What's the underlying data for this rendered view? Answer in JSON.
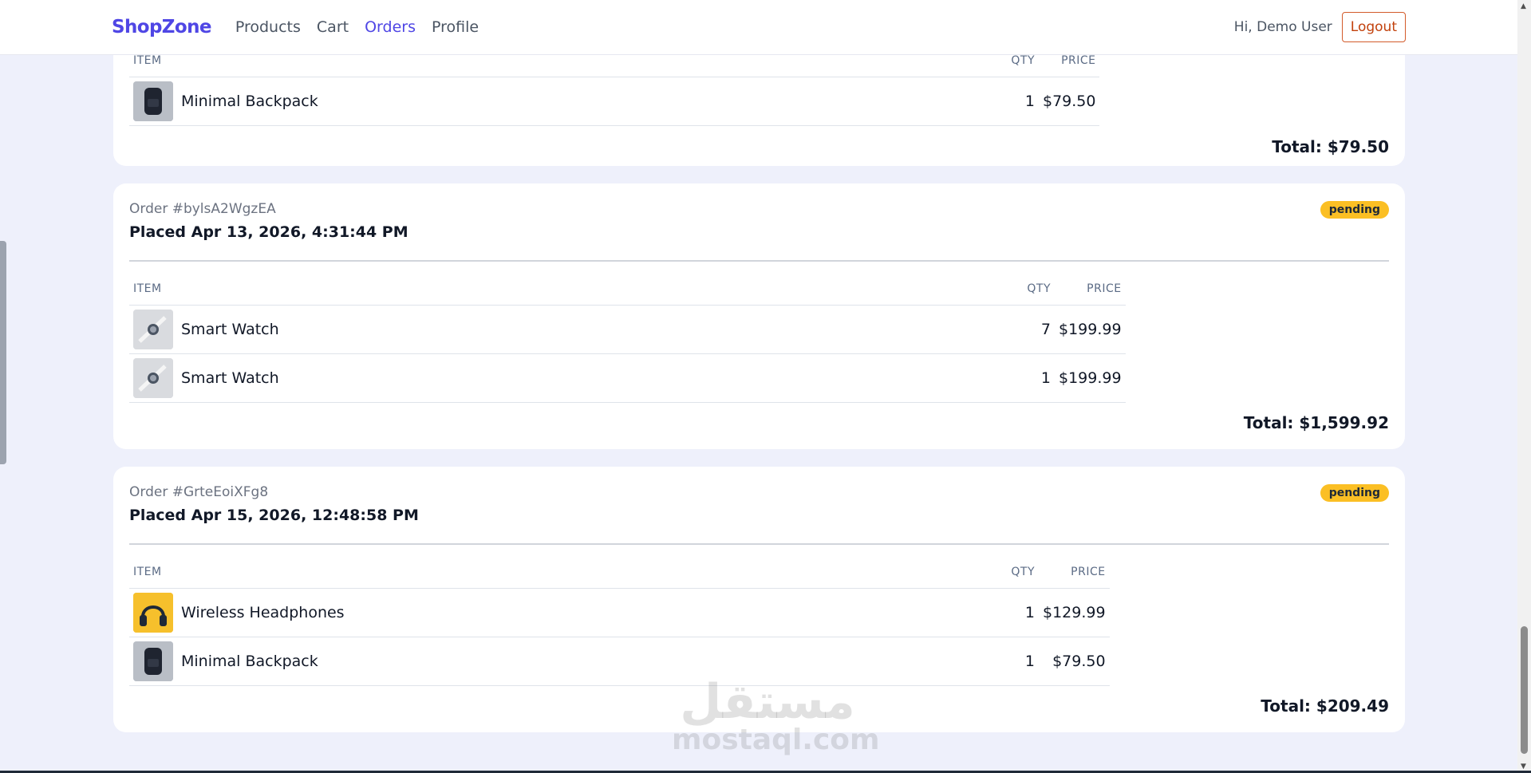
{
  "nav": {
    "brand": "ShopZone",
    "links": [
      "Products",
      "Cart",
      "Orders",
      "Profile"
    ],
    "active": "Orders",
    "greeting": "Hi, Demo User",
    "logout": "Logout"
  },
  "table_headers": {
    "item": "ITEM",
    "qty": "QTY",
    "price": "PRICE"
  },
  "orders": [
    {
      "items": [
        {
          "name": "Minimal Backpack",
          "qty": "1",
          "price": "$79.50",
          "thumb": "backpack-image"
        }
      ],
      "total": "Total: $79.50"
    },
    {
      "id_label": "Order #bylsA2WgzEA",
      "placed": "Placed Apr 13, 2026, 4:31:44 PM",
      "status": "pending",
      "items": [
        {
          "name": "Smart Watch",
          "qty": "7",
          "price": "$199.99",
          "thumb": "smart-watch-image"
        },
        {
          "name": "Smart Watch",
          "qty": "1",
          "price": "$199.99",
          "thumb": "smart-watch-image"
        }
      ],
      "total": "Total: $1,599.92"
    },
    {
      "id_label": "Order #GrteEoiXFg8",
      "placed": "Placed Apr 15, 2026, 12:48:58 PM",
      "status": "pending",
      "items": [
        {
          "name": "Wireless Headphones",
          "qty": "1",
          "price": "$129.99",
          "thumb": "headphones-image"
        },
        {
          "name": "Minimal Backpack",
          "qty": "1",
          "price": "$79.50",
          "thumb": "backpack-image"
        }
      ],
      "total": "Total: $209.49"
    }
  ],
  "watermark": {
    "arabic": "مستقل",
    "latin": "mostaql.com"
  },
  "colors": {
    "accent": "#4f46e5",
    "badge": "#fbbf24",
    "logout": "#c2410c",
    "background": "#eef0fb"
  }
}
